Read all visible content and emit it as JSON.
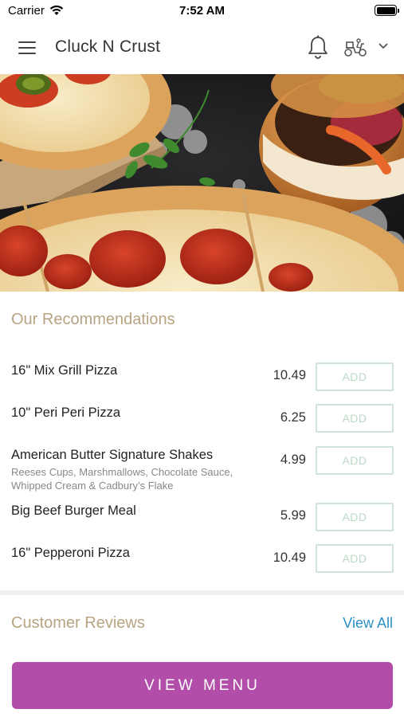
{
  "status_bar": {
    "carrier": "Carrier",
    "time": "7:52 AM",
    "battery_icon": "battery-full-icon",
    "wifi_icon": "wifi-icon"
  },
  "header": {
    "title": "Cluck N Crust",
    "menu_icon": "hamburger-menu-icon",
    "notification_icon": "bell-icon",
    "order_mode_icon": "scooter-icon",
    "dropdown_icon": "chevron-down-icon"
  },
  "hero": {
    "description_icon": "food-banner-image"
  },
  "recommendations": {
    "title": "Our Recommendations",
    "add_label": "ADD",
    "items": [
      {
        "name": "16\" Mix Grill Pizza",
        "description": "",
        "price": "10.49"
      },
      {
        "name": "10\" Peri Peri Pizza",
        "description": "",
        "price": "6.25"
      },
      {
        "name": "American Butter Signature Shakes",
        "description": "Reeses Cups, Marshmallows, Chocolate Sauce, Whipped Cream & Cadbury’s Flake",
        "price": "4.99"
      },
      {
        "name": "Big Beef Burger Meal",
        "description": "",
        "price": "5.99"
      },
      {
        "name": "16\" Pepperoni Pizza",
        "description": "",
        "price": "10.49"
      }
    ]
  },
  "reviews": {
    "title": "Customer Reviews",
    "view_all_label": "View All"
  },
  "footer": {
    "view_menu_label": "VIEW MENU"
  },
  "colors": {
    "accent_gold": "#b8a382",
    "link_blue": "#2c8fc4",
    "primary_purple": "#b24ea9",
    "add_green": "#cfe4d6"
  }
}
